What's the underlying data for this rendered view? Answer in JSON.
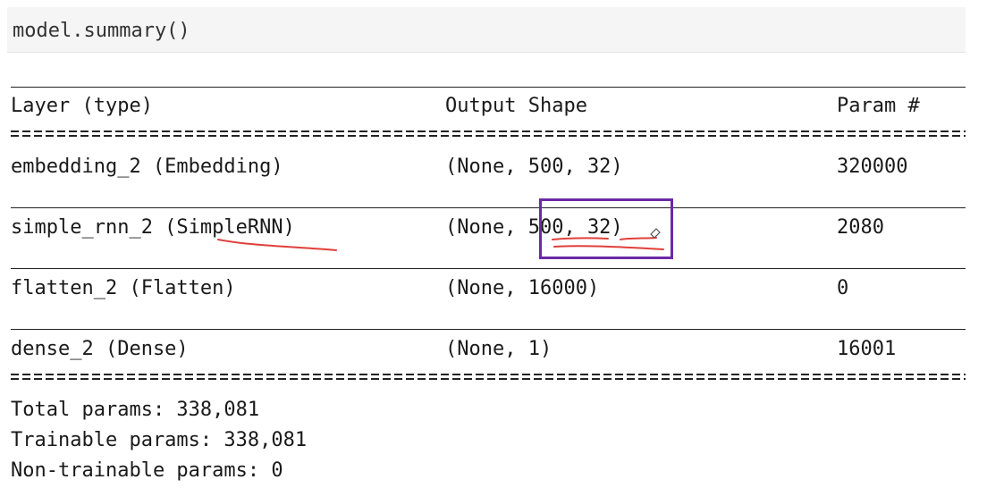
{
  "cell": {
    "input_code": "model.summary()"
  },
  "summary": {
    "headers": {
      "layer": "Layer (type)",
      "output_shape": "Output Shape",
      "params": "Param #"
    },
    "rows": [
      {
        "layer": "embedding_2 (Embedding)",
        "output_shape": "(None, 500, 32)",
        "params": "320000"
      },
      {
        "layer": "simple_rnn_2 (SimpleRNN)",
        "output_shape": "(None, 500, 32)",
        "params": "2080"
      },
      {
        "layer": "flatten_2 (Flatten)",
        "output_shape": "(None, 16000)",
        "params": "0"
      },
      {
        "layer": "dense_2 (Dense)",
        "output_shape": "(None, 1)",
        "params": "16001"
      }
    ],
    "totals": {
      "total": "Total params: 338,081",
      "trainable": "Trainable params: 338,081",
      "non_trainable": "Non-trainable params: 0"
    }
  },
  "annotations": {
    "box_color": "#6b2aa5",
    "underline_color": "#e0403a"
  }
}
